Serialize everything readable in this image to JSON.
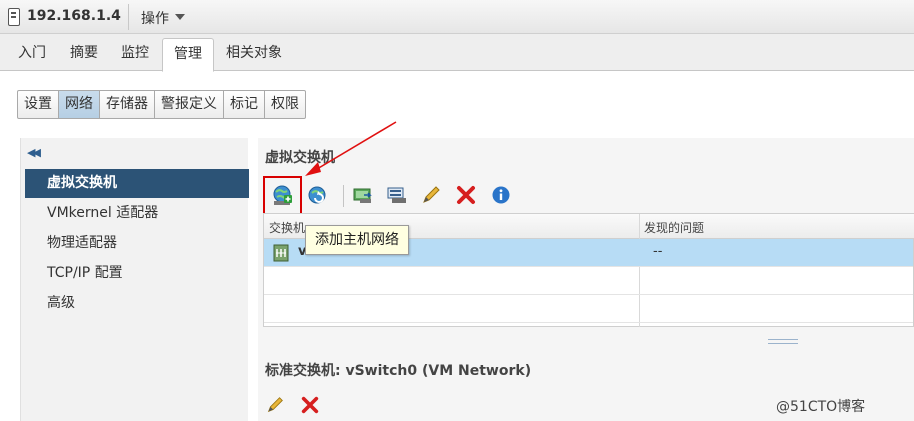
{
  "title_bar": {
    "host": "192.168.1.4",
    "actions_label": "操作"
  },
  "main_tabs": [
    {
      "label": "入门",
      "active": false
    },
    {
      "label": "摘要",
      "active": false
    },
    {
      "label": "监控",
      "active": false
    },
    {
      "label": "管理",
      "active": true
    },
    {
      "label": "相关对象",
      "active": false
    }
  ],
  "sub_tabs": [
    {
      "label": "设置",
      "active": false
    },
    {
      "label": "网络",
      "active": true
    },
    {
      "label": "存储器",
      "active": false
    },
    {
      "label": "警报定义",
      "active": false
    },
    {
      "label": "标记",
      "active": false
    },
    {
      "label": "权限",
      "active": false
    }
  ],
  "left_nav": {
    "collapse_icon": "double-chevron-left-icon",
    "items": [
      {
        "label": "虚拟交换机",
        "active": true
      },
      {
        "label": "VMkernel 适配器",
        "active": false
      },
      {
        "label": "物理适配器",
        "active": false
      },
      {
        "label": "TCP/IP 配置",
        "active": false
      },
      {
        "label": "高级",
        "active": false
      }
    ]
  },
  "content": {
    "section_title": "虚拟交换机",
    "toolbar_icons": [
      "add-host-networking-icon",
      "refresh-icon",
      "migrate-adapter-icon",
      "manage-adapters-icon",
      "edit-pencil-icon",
      "delete-x-icon",
      "info-icon"
    ],
    "tooltip": "添加主机网络",
    "table": {
      "columns": [
        "交换机",
        "发现的问题"
      ],
      "rows": [
        {
          "name": "vSwitch0",
          "issues": "--",
          "selected": true
        },
        {
          "name": "",
          "issues": "",
          "selected": false
        },
        {
          "name": "",
          "issues": "",
          "selected": false
        }
      ]
    },
    "section2_title": "标准交换机: vSwitch0 (VM Network)",
    "toolbar2_icons": [
      "edit-pencil-icon",
      "delete-x-icon"
    ]
  },
  "colors": {
    "nav_active": "#2c5376",
    "selected_row": "#b7dcf5",
    "highlight_red": "#d80000",
    "tooltip_bg": "#ffffe1"
  },
  "watermark": "@51CTO博客"
}
